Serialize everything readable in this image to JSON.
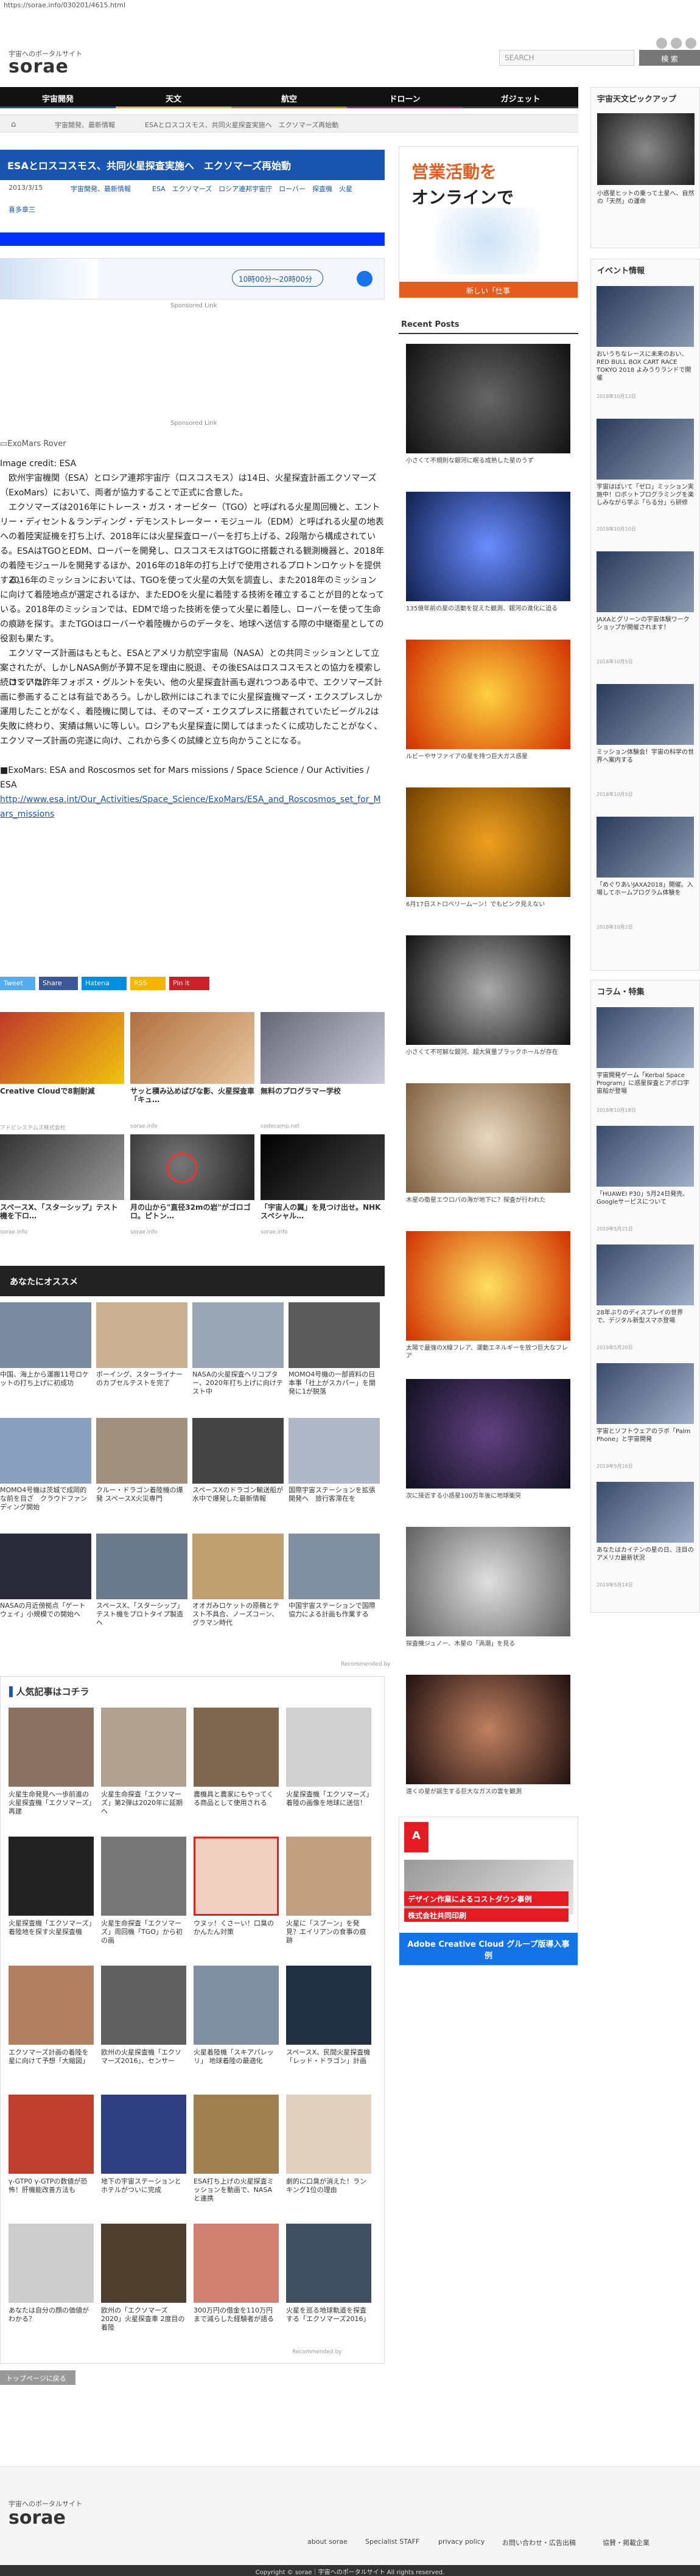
{
  "url": "https://sorae.info/030201/4615.html",
  "header": {
    "tagline": "宇宙へのポータルサイト",
    "logo": "sorae",
    "search_placeholder": "SEARCH",
    "search_button": "検 索"
  },
  "nav": {
    "items": [
      {
        "label": "宇宙開発",
        "color": "#1a55b0"
      },
      {
        "label": "天文",
        "color": "#e8c400"
      },
      {
        "label": "航空",
        "color": "#e8720c"
      },
      {
        "label": "ドローン",
        "color": "#cc1577"
      },
      {
        "label": "ガジェット",
        "color": "#111111"
      }
    ]
  },
  "breadcrumb": [
    "宇宙開発、最新情報",
    "ESAとロスコスモス、共同火星探査実施へ　エクソマーズ再始動"
  ],
  "article": {
    "title": "ESAとロスコスモス、共同火星探査実施へ　エクソマーズ再始動",
    "date": "2013/3/15",
    "category": "宇宙開発、最新情報",
    "tags": "ESA　エクソマーズ　ロシア連邦宇宙庁　ローバー　探査機　火星",
    "author": "喜多章三",
    "ad_text": "10時00分〜20時00分",
    "sponsored": "Sponsored Link",
    "image_alt": "ExoMars Rover",
    "image_credit": "Image credit: ESA",
    "paragraphs": [
      "　欧州宇宙機関（ESA）とロシア連邦宇宙庁（ロスコスモス）は14日、火星探査計画エクソマーズ（ExoMars）において、両者が協力することで正式に合意した。",
      "　エクソマーズは2016年にトレース・ガス・オービター（TGO）と呼ばれる火星周回機と、エントリー・ディセント＆ランディング・デモンストレーター・モジュール（EDM）と呼ばれる火星の地表への着陸実証機を打ち上げ、2018年には火星探査ローバーを打ち上げる、2段階から構成されている。ESAはTGOとEDM、ローバーを開発し、ロスコスモスはTGOに搭載される観測機器と、2018年の着陸モジュールを開発するほか、2016年の18年の打ち上げで使用されるプロトンロケットを提供する。",
      "　2016年のミッションにおいては、TGOを使って火星の大気を調査し、また2018年のミッションに向けて着陸地点が選定されるほか、またEDOを火星に着陸する技術を確立することが目的となっている。2018年のミッションでは、EDMで培った技術を使って火星に着陸し、ローバーを使って生命の痕跡を探す。またTGOはローバーや着陸機からのデータを、地球へ送信する際の中継衛星としての役割も果たす。",
      "　エクソマーズ計画はもともと、ESAとアメリカ航空宇宙局（NASA）との共同ミッションとして立案されたが、しかしNASA側が予算不足を理由に脱退、その後ESAはロスコスモスとの協力を模索し続けていた。",
      "　ロシアは昨年フォボス・グルントを失い、他の火星探査計画も遅れつつある中で、エクソマーズ計画に参画することは有益であろう。しかし欧州にはこれまでに火星探査機マーズ・エクスプレスしか運用したことがなく、着陸機に関しては、そのマーズ・エクスプレスに搭載されていたビーグル2は失敗に終わり、実績は無いに等しい。ロシアも火星探査に関してはまったくに成功したことがなく、エクソマーズ計画の完遂に向け、これから多くの試練と立ち向かうことになる。",
      "■ExoMars: ESA and Roscosmos set for Mars missions / Space Science / Our Activities / ESA"
    ],
    "link": "http://www.esa.int/Our_Activities/Space_Science/ExoMars/ESA_and_Roscosmos_set_for_Mars_missions"
  },
  "share": [
    {
      "label": "Tweet",
      "color": "#55acee"
    },
    {
      "label": "Share",
      "color": "#3b5998"
    },
    {
      "label": "Hatena",
      "color": "#008fde"
    },
    {
      "label": "RSS",
      "color": "#f4b400"
    },
    {
      "label": "Pin it",
      "color": "#cb2027"
    }
  ],
  "ad_row_1": [
    {
      "caption": "Creative Cloudで8割耐減",
      "sub": "アドビシステムズ株式会社"
    },
    {
      "caption": "サッと積み込めばびな影、火星探査車「キュ…",
      "sub": "sorae.info"
    },
    {
      "caption": "無料のプログラマー学校",
      "sub": "codecamp.net"
    }
  ],
  "ad_row_2": [
    {
      "caption": "スペースX、「スターシップ」テスト機を下ロ…",
      "sub": "sorae.info"
    },
    {
      "caption": "月の山から\"直径32mの岩\"がゴロゴロ。ピトン…",
      "sub": "sorae.info"
    },
    {
      "caption": "「宇宙人の翼」を見つけ出せ。NHKスペシャル…",
      "sub": "sorae.info"
    }
  ],
  "recommend": {
    "title": "あなたにオススメ",
    "items": [
      "中国、海上から運搬11号ロケットの打ち上げに初成功",
      "ボーイング、スターライナーのカプセルテストを完了",
      "NASAの火星探査ヘリコプター、2020年打ち上げに向けテスト中",
      "MOMO4号機の一部資料の日本事「社上がスカパー」を開発に1が脱落",
      "MOMO4号機は茨城で成岡的な前を目ざ　クラウドファンディング開始",
      "クルー・ドラゴン着陸機の爆発 スペースX火災専門",
      "スペースXのドラゴン輸送船が水中で爆発した最新情報",
      "国際宇宙ステーションを拡張開発へ　旅行客滞在を",
      "NASAの月近傍拠点「ゲートウェイ」小規模での開始へ",
      "スペースX、「スターシップ」テスト機をプロトタイプ製造へ",
      "オオガみロケットの原稿とテスト不具合、ノーズコーン、グラマン時代",
      "中国宇宙ステーションで国際協力による計画も作業する"
    ],
    "footer": "Recommended by"
  },
  "popular": {
    "title": "人気記事はコチラ",
    "items": [
      "火星生命発見へ一歩前進の火星探査機「エクソマーズ」再建",
      "火星生命探査「エクソマーズ」第2弾は2020年に延期へ",
      "農機具と農家にもやってくる商品として使用される",
      "火星探査機「エクソマーズ」着陸の画像を地球に送信！",
      "火星探査機「エクソマーズ」着陸地を探す火星探査機",
      "火星生命探査「エクソマーズ」周回機「TGO」から初の画",
      "ウヌッ！くさーい！口臭のかんたん対策",
      "火星に「スプーン」を発見？エイリアンの食事の痕跡",
      "エクソマーズ計画の着陸を星に向けて予想「大縮図」",
      "欧州の火星探査機「エクソマーズ2016」、センサー",
      "火星着陸機「スキアパレッリ」 地球着陸の最適化",
      "スペースX、民間火星探査機「レッド・ドラゴン」計画",
      "γ-GTP0 γ-GTPの数値が恐怖！肝機能改善方法も",
      "地下の宇宙ステーションとホテルがついに完成",
      "ESA打ち上げの火星探査ミッションを動画で、NASAと連携",
      "劇的に口臭が消えた！ランキング1位の理由",
      "あなたは自分の顔の価値がわかる？",
      "欧州の「エクソマーズ2020」火星探査車 2度目の着陸",
      "300万円の借金を110万円まで減らした経験者が語る",
      "火星を巡る地球軌道を探査する「エクソマーズ2016」"
    ],
    "footer": "Recommended by"
  },
  "back_to_top": "トップページに戻る",
  "footer": {
    "tagline": "宇宙へのポータルサイト",
    "logo": "sorae",
    "links": [
      "about sorae",
      "Specialist STAFF",
      "privacy policy",
      "お問い合わせ・広告出稿",
      "協賛・掲載企業"
    ],
    "copyright": "Copyright © sorae｜宇宙へのポータルサイト All rights reserved."
  },
  "sidebar_ad": {
    "headline": "営業活動を",
    "headline2": "オンラインで",
    "sub": "新しい「仕事のしかた」"
  },
  "recent_posts": {
    "title": "Recent Posts",
    "items": [
      "小さくて不規則な銀河に眠る成熟した星のうず",
      "135億年前の星の活動を捉えた観測、銀河の進化に迫る",
      "ルビーやサファイアの星を持つ巨大ガス惑星",
      "6月17日ストロベリームーン！でもピンク見えない",
      "小さくて不可解な銀河、超大質量ブラックホールが存在",
      "木星の衛星エウロパの海が地下に？探査が行われた",
      "太陽で最強のX線フレア、運動エネルギーを放つ巨大なフレア",
      "次に接近する小惑星100万年後に地球衝突",
      "探査機ジュノー、木星の「渦潮」を見る",
      "遠くの星が誕生する巨大なガスの雲を観測"
    ],
    "ad_headline": "デザイン作業によるコストダウン事例",
    "ad_company": "株式会社共同印刷",
    "ad_footer": "Adobe Creative Cloud グループ版導入事例"
  },
  "right_column": {
    "pickup_title": "宇宙天文ピックアップ",
    "pickup_caption": "小惑星ヒットの乗って土星へ、自然の「天然」の運命",
    "events_title": "イベント情報",
    "events": [
      {
        "caption": "おいうちなレースに未来のおい、RED BULL BOX CART RACE TOKYO 2018 よみうりランドで開催",
        "date": "2018年10月12日"
      },
      {
        "caption": "宇宙はばいて「ゼロ」ミッション実施中！ロボットプログラミングを楽しみながら学ぶ「らる分」ら研修",
        "date": "2018年10月10日"
      },
      {
        "caption": "JAXAとグリーンの宇宙体験ワークショップが開催されます！",
        "date": "2018年10月5日"
      },
      {
        "caption": "ミッション体験会！宇宙の科学の世界へ案内する",
        "date": "2018年10月5日"
      },
      {
        "caption": "「めぐりあいJAXA2018」開催。入場してホームプログラム体験を",
        "date": "2018年10月2日"
      }
    ],
    "columns_title": "コラム・特集",
    "columns": [
      {
        "caption": "宇宙開発ゲーム「Kerbal Space Program」に惑星探査とアポロ宇宙船が登場",
        "date": "2018年10月18日"
      },
      {
        "caption": "「HUAWEI P30」5月24日発売、Googleサービスについて",
        "date": "2019年5月21日"
      },
      {
        "caption": "28年ぶりのディスプレイの世界で、デジタル新型スマホ登場",
        "date": "2019年5月20日"
      },
      {
        "caption": "宇宙とソフトウェアのラボ「Palm Phone」と宇宙開発",
        "date": "2019年5月16日"
      },
      {
        "caption": "あなたはカイテンの星の日、注目のアメリカ最新状況",
        "date": "2019年5月14日"
      }
    ]
  }
}
